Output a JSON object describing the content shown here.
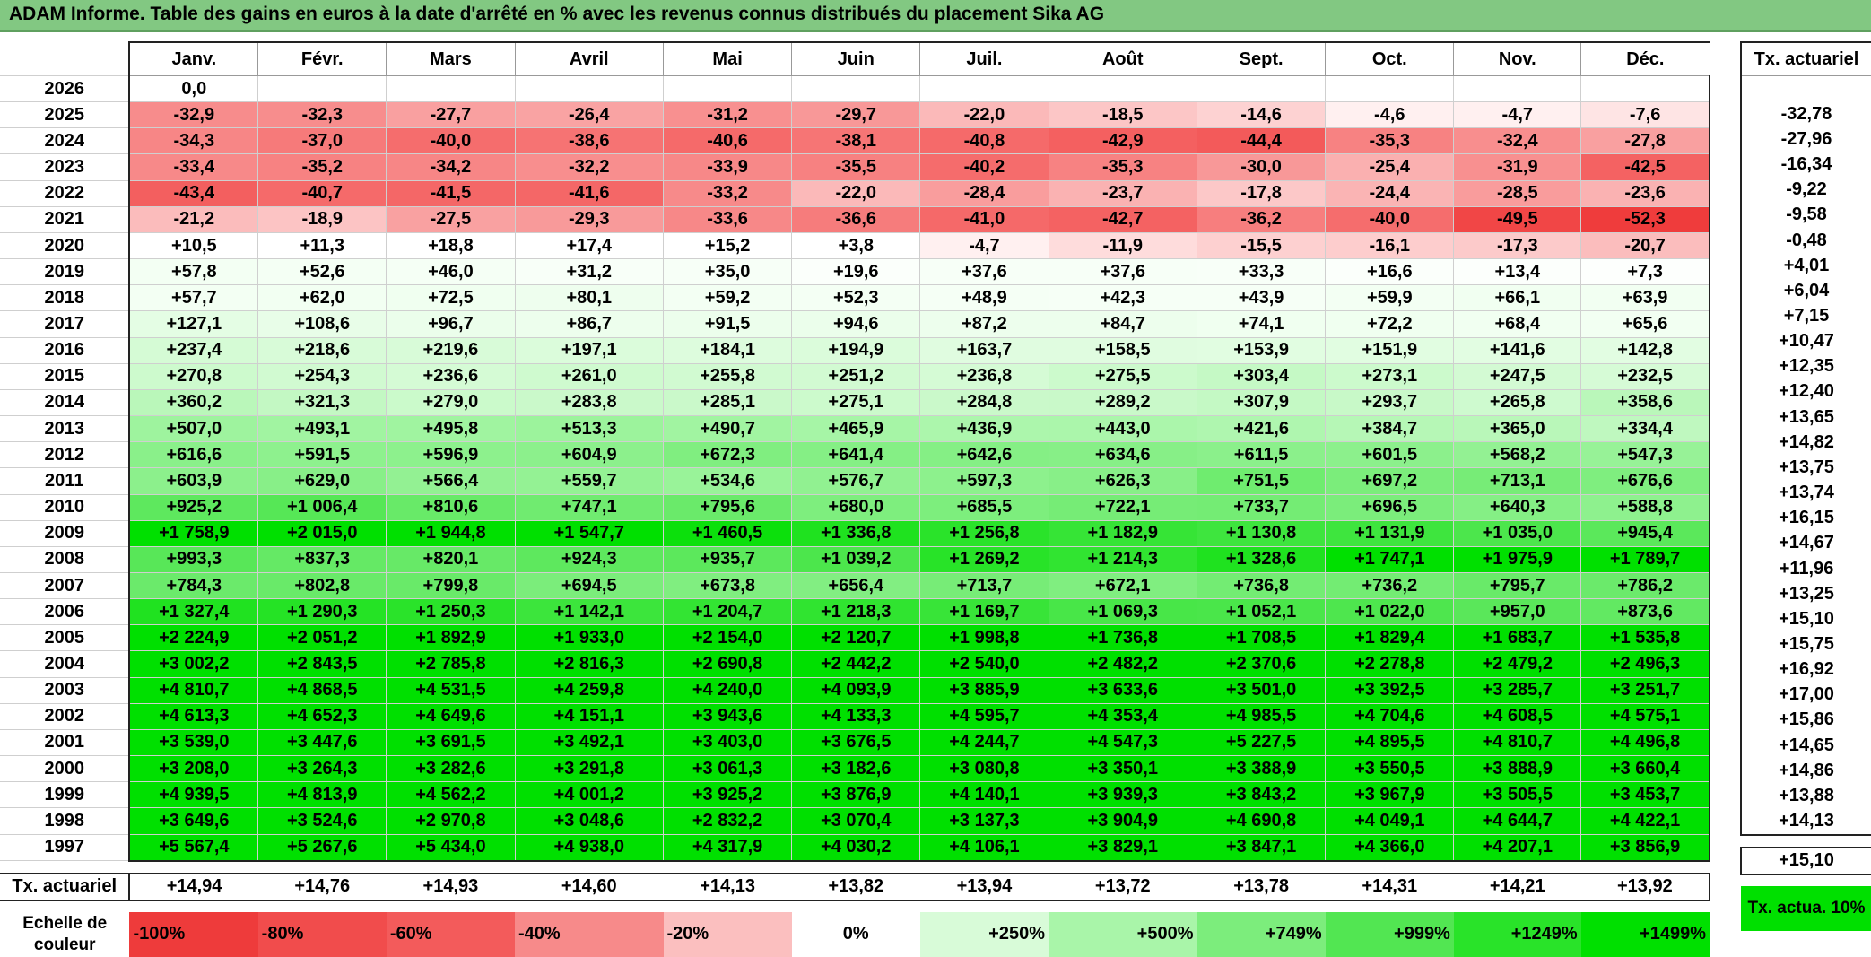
{
  "title": "ADAM Informe. Table des gains en euros à la date d'arrêté en % avec les revenus connus distribués du placement Sika AG",
  "months": [
    "Janv.",
    "Févr.",
    "Mars",
    "Avril",
    "Mai",
    "Juin",
    "Juil.",
    "Août",
    "Sept.",
    "Oct.",
    "Nov.",
    "Déc."
  ],
  "actuarial_header": "Tx. actuariel",
  "rows": [
    {
      "year": "2026",
      "values": [
        "0,0",
        "",
        "",
        "",
        "",
        "",
        "",
        "",
        "",
        "",
        "",
        ""
      ],
      "colors": [
        "#ffffff",
        "#ffffff",
        "#ffffff",
        "#ffffff",
        "#ffffff",
        "#ffffff",
        "#ffffff",
        "#ffffff",
        "#ffffff",
        "#ffffff",
        "#ffffff",
        "#ffffff"
      ],
      "rate": ""
    },
    {
      "year": "2025",
      "values": [
        "-32,9",
        "-32,3",
        "-27,7",
        "-26,4",
        "-31,2",
        "-29,7",
        "-22,0",
        "-18,5",
        "-14,6",
        "-4,6",
        "-4,7",
        "-7,6"
      ],
      "colors": [
        "#f78c8c",
        "#f78d8d",
        "#f9a0a0",
        "#f9a3a3",
        "#f89090",
        "#f89898",
        "#fbb9b9",
        "#fcc6c6",
        "#fdd2d2",
        "#fff0f0",
        "#fff0f0",
        "#fee4e4"
      ],
      "rate": "-32,78"
    },
    {
      "year": "2024",
      "values": [
        "-34,3",
        "-37,0",
        "-40,0",
        "-38,6",
        "-40,6",
        "-38,1",
        "-40,8",
        "-42,9",
        "-44,4",
        "-35,3",
        "-32,4",
        "-27,8"
      ],
      "colors": [
        "#f78686",
        "#f67a7a",
        "#f56d6d",
        "#f67373",
        "#f56a6a",
        "#f67575",
        "#f56a6a",
        "#f46060",
        "#f35a5a",
        "#f78282",
        "#f88e8e",
        "#f9a0a0"
      ],
      "rate": "-27,96"
    },
    {
      "year": "2023",
      "values": [
        "-33,4",
        "-35,2",
        "-34,2",
        "-32,2",
        "-33,9",
        "-35,5",
        "-40,2",
        "-35,3",
        "-30,0",
        "-25,4",
        "-31,9",
        "-42,5"
      ],
      "colors": [
        "#f78989",
        "#f78282",
        "#f78686",
        "#f88e8e",
        "#f78888",
        "#f78181",
        "#f56c6c",
        "#f78282",
        "#f89898",
        "#fab0b0",
        "#f89090",
        "#f46262"
      ],
      "rate": "-16,34"
    },
    {
      "year": "2022",
      "values": [
        "-43,4",
        "-40,7",
        "-41,5",
        "-41,6",
        "-33,2",
        "-22,0",
        "-28,4",
        "-23,7",
        "-17,8",
        "-24,4",
        "-28,5",
        "-23,6"
      ],
      "colors": [
        "#f35f5f",
        "#f56a6a",
        "#f46767",
        "#f46767",
        "#f78a8a",
        "#fbb9b9",
        "#f99d9d",
        "#fab2b2",
        "#fcc8c8",
        "#fab4b4",
        "#f99c9c",
        "#fab2b2"
      ],
      "rate": "-9,22"
    },
    {
      "year": "2021",
      "values": [
        "-21,2",
        "-18,9",
        "-27,5",
        "-29,3",
        "-33,6",
        "-36,6",
        "-41,0",
        "-42,7",
        "-36,2",
        "-40,0",
        "-49,5",
        "-52,3"
      ],
      "colors": [
        "#fbbcbc",
        "#fcc4c4",
        "#f9a1a1",
        "#f89a9a",
        "#f78888",
        "#f67c7c",
        "#f56969",
        "#f46262",
        "#f77e7e",
        "#f56d6d",
        "#f14646",
        "#ef3c3c"
      ],
      "rate": "-9,58"
    },
    {
      "year": "2020",
      "values": [
        "+10,5",
        "+11,3",
        "+18,8",
        "+17,4",
        "+15,2",
        "+3,8",
        "-4,7",
        "-11,9",
        "-15,5",
        "-16,1",
        "-17,3",
        "-20,7"
      ],
      "colors": [
        "#ffffff",
        "#ffffff",
        "#ffffff",
        "#ffffff",
        "#ffffff",
        "#ffffff",
        "#fff0f0",
        "#fedcdc",
        "#fdd0d0",
        "#fdcdcd",
        "#fccaca",
        "#fbbdbd"
      ],
      "rate": "-0,48"
    },
    {
      "year": "2019",
      "values": [
        "+57,8",
        "+52,6",
        "+46,0",
        "+31,2",
        "+35,0",
        "+19,6",
        "+37,6",
        "+37,6",
        "+33,3",
        "+16,6",
        "+13,4",
        "+7,3"
      ],
      "colors": [
        "#f3fff3",
        "#f4fff4",
        "#f5fff5",
        "#f8fff8",
        "#f7fff7",
        "#fbfffb",
        "#f7fff7",
        "#f7fff7",
        "#f8fff8",
        "#fbfffb",
        "#fcfffc",
        "#fdfffd"
      ],
      "rate": "+4,01"
    },
    {
      "year": "2018",
      "values": [
        "+57,7",
        "+62,0",
        "+72,5",
        "+80,1",
        "+59,2",
        "+52,3",
        "+48,9",
        "+42,3",
        "+43,9",
        "+59,9",
        "+66,1",
        "+63,9"
      ],
      "colors": [
        "#f3fff3",
        "#f2fff2",
        "#f0fff0",
        "#eefeee",
        "#f3fff3",
        "#f4fff4",
        "#f5fff5",
        "#f6fff6",
        "#f6fff6",
        "#f3fff3",
        "#f1fff1",
        "#f2fff2"
      ],
      "rate": "+6,04"
    },
    {
      "year": "2017",
      "values": [
        "+127,1",
        "+108,6",
        "+96,7",
        "+86,7",
        "+91,5",
        "+94,6",
        "+87,2",
        "+84,7",
        "+74,1",
        "+72,2",
        "+68,4",
        "+65,6"
      ],
      "colors": [
        "#e4fde4",
        "#e8fde8",
        "#ebfeeb",
        "#edfeed",
        "#ecfeec",
        "#ebfeeb",
        "#edfeed",
        "#edfeed",
        "#f0fff0",
        "#f0fff0",
        "#f1fff1",
        "#f2fff2"
      ],
      "rate": "+7,15"
    },
    {
      "year": "2016",
      "values": [
        "+237,4",
        "+218,6",
        "+219,6",
        "+197,1",
        "+184,1",
        "+194,9",
        "+163,7",
        "+158,5",
        "+153,9",
        "+151,9",
        "+141,6",
        "+142,8"
      ],
      "colors": [
        "#d5fbd5",
        "#d8fbd8",
        "#d8fbd8",
        "#dbfcdb",
        "#ddfcdd",
        "#dbfcdb",
        "#e0fce0",
        "#e0fce0",
        "#e1fde1",
        "#e1fde1",
        "#e2fde2",
        "#e2fde2"
      ],
      "rate": "+10,47"
    },
    {
      "year": "2015",
      "values": [
        "+270,8",
        "+254,3",
        "+236,6",
        "+261,0",
        "+255,8",
        "+251,2",
        "+236,8",
        "+275,5",
        "+303,4",
        "+273,1",
        "+247,5",
        "+232,5"
      ],
      "colors": [
        "#cdfacd",
        "#d1fad1",
        "#d5fbd5",
        "#cffacf",
        "#d1fad1",
        "#d2fad2",
        "#d5fbd5",
        "#ccfacc",
        "#c5f9c5",
        "#ccfacc",
        "#d3fad3",
        "#d6fbd6"
      ],
      "rate": "+12,35"
    },
    {
      "year": "2014",
      "values": [
        "+360,2",
        "+321,3",
        "+279,0",
        "+283,8",
        "+285,1",
        "+275,1",
        "+284,8",
        "+289,2",
        "+307,9",
        "+293,7",
        "+265,8",
        "+358,6"
      ],
      "colors": [
        "#baf7ba",
        "#c3f8c3",
        "#cbfacb",
        "#caf9ca",
        "#caf9ca",
        "#ccfacc",
        "#caf9ca",
        "#c9f9c9",
        "#c4f9c4",
        "#c8f9c8",
        "#cefacf",
        "#baf7ba"
      ],
      "rate": "+12,40"
    },
    {
      "year": "2013",
      "values": [
        "+507,0",
        "+493,1",
        "+495,8",
        "+513,3",
        "+490,7",
        "+465,9",
        "+436,9",
        "+443,0",
        "+421,6",
        "+384,7",
        "+365,0",
        "+334,4"
      ],
      "colors": [
        "#9ef39e",
        "#a1f4a1",
        "#a0f4a0",
        "#9cf39c",
        "#a1f4a1",
        "#a6f5a6",
        "#acf6ac",
        "#abf6ab",
        "#aff6af",
        "#b6f7b6",
        "#b9f7b9",
        "#bff8bf"
      ],
      "rate": "+13,65"
    },
    {
      "year": "2012",
      "values": [
        "+616,6",
        "+591,5",
        "+596,9",
        "+604,9",
        "+672,3",
        "+641,4",
        "+642,6",
        "+634,6",
        "+611,5",
        "+601,5",
        "+568,2",
        "+547,3"
      ],
      "colors": [
        "#8af08a",
        "#8ef18e",
        "#8df18d",
        "#8cf08c",
        "#80ee80",
        "#85ef85",
        "#85ef85",
        "#87ef87",
        "#8bf08b",
        "#8cf08c",
        "#93f193",
        "#97f297"
      ],
      "rate": "+14,82"
    },
    {
      "year": "2011",
      "values": [
        "+603,9",
        "+629,0",
        "+566,4",
        "+559,7",
        "+534,6",
        "+576,7",
        "+597,3",
        "+626,3",
        "+751,5",
        "+697,2",
        "+713,1",
        "+676,6"
      ],
      "colors": [
        "#8cf08c",
        "#88ef88",
        "#93f193",
        "#94f294",
        "#99f399",
        "#91f191",
        "#8df18d",
        "#88ef88",
        "#6fec6f",
        "#7bed7b",
        "#77ec77",
        "#7fee7f"
      ],
      "rate": "+13,75"
    },
    {
      "year": "2010",
      "values": [
        "+925,2",
        "+1 006,4",
        "+810,6",
        "+747,1",
        "+795,6",
        "+680,0",
        "+685,5",
        "+722,1",
        "+733,7",
        "+696,5",
        "+640,3",
        "+588,8"
      ],
      "colors": [
        "#5ee85e",
        "#56e756",
        "#68ea68",
        "#70eb70",
        "#6aea6a",
        "#7eee7e",
        "#7dee7d",
        "#76ec76",
        "#74ec74",
        "#7bed7b",
        "#85ef85",
        "#8ef18e"
      ],
      "rate": "+13,74"
    },
    {
      "year": "2009",
      "values": [
        "+1 758,9",
        "+2 015,0",
        "+1 944,8",
        "+1 547,7",
        "+1 460,5",
        "+1 336,8",
        "+1 256,8",
        "+1 182,9",
        "+1 130,8",
        "+1 131,9",
        "+1 035,0",
        "+945,4"
      ],
      "colors": [
        "#00e000",
        "#00e000",
        "#00e000",
        "#00e000",
        "#0ce00c",
        "#1fe21f",
        "#2ae32a",
        "#36e436",
        "#3ee53e",
        "#3ee53e",
        "#4ce64c",
        "#5be85b"
      ],
      "rate": "+16,15"
    },
    {
      "year": "2008",
      "values": [
        "+993,3",
        "+837,3",
        "+820,1",
        "+924,3",
        "+935,7",
        "+1 039,2",
        "+1 269,2",
        "+1 214,3",
        "+1 328,6",
        "+1 747,1",
        "+1 975,9",
        "+1 789,7"
      ],
      "colors": [
        "#58e758",
        "#65e965",
        "#67e967",
        "#5ee85e",
        "#5ce85c",
        "#4ce64c",
        "#28e328",
        "#31e431",
        "#1fe21f",
        "#00e000",
        "#00e000",
        "#00e000"
      ],
      "rate": "+14,67"
    },
    {
      "year": "2007",
      "values": [
        "+784,3",
        "+802,8",
        "+799,8",
        "+694,5",
        "+673,8",
        "+656,4",
        "+713,7",
        "+672,1",
        "+736,8",
        "+736,2",
        "+795,7",
        "+786,2"
      ],
      "colors": [
        "#6bea6b",
        "#69ea69",
        "#69ea69",
        "#7bed7b",
        "#80ee80",
        "#82ee82",
        "#77ec77",
        "#80ee80",
        "#73ec73",
        "#73ec73",
        "#69ea69",
        "#6bea6b"
      ],
      "rate": "+11,96"
    },
    {
      "year": "2006",
      "values": [
        "+1 327,4",
        "+1 290,3",
        "+1 250,3",
        "+1 142,1",
        "+1 204,7",
        "+1 218,3",
        "+1 169,7",
        "+1 069,3",
        "+1 052,1",
        "+1 022,0",
        "+957,0",
        "+873,6"
      ],
      "colors": [
        "#20e220",
        "#25e325",
        "#2ae32a",
        "#3ce53c",
        "#33e433",
        "#30e430",
        "#38e438",
        "#48e648",
        "#4ae64a",
        "#4ee64e",
        "#5ae75a",
        "#62e962"
      ],
      "rate": "+13,25"
    },
    {
      "year": "2005",
      "values": [
        "+2 224,9",
        "+2 051,2",
        "+1 892,9",
        "+1 933,0",
        "+2 154,0",
        "+2 120,7",
        "+1 998,8",
        "+1 736,8",
        "+1 708,5",
        "+1 829,4",
        "+1 683,7",
        "+1 535,8"
      ],
      "colors": [
        "#00e000",
        "#00e000",
        "#00e000",
        "#00e000",
        "#00e000",
        "#00e000",
        "#00e000",
        "#00e000",
        "#00e000",
        "#00e000",
        "#00e000",
        "#00e000"
      ],
      "rate": "+15,10"
    },
    {
      "year": "2004",
      "values": [
        "+3 002,2",
        "+2 843,5",
        "+2 785,8",
        "+2 816,3",
        "+2 690,8",
        "+2 442,2",
        "+2 540,0",
        "+2 482,2",
        "+2 370,6",
        "+2 278,8",
        "+2 479,2",
        "+2 496,3"
      ],
      "colors": [
        "#00e000",
        "#00e000",
        "#00e000",
        "#00e000",
        "#00e000",
        "#00e000",
        "#00e000",
        "#00e000",
        "#00e000",
        "#00e000",
        "#00e000",
        "#00e000"
      ],
      "rate": "+15,75"
    },
    {
      "year": "2003",
      "values": [
        "+4 810,7",
        "+4 868,5",
        "+4 531,5",
        "+4 259,8",
        "+4 240,0",
        "+4 093,9",
        "+3 885,9",
        "+3 633,6",
        "+3 501,0",
        "+3 392,5",
        "+3 285,7",
        "+3 251,7"
      ],
      "colors": [
        "#00e000",
        "#00e000",
        "#00e000",
        "#00e000",
        "#00e000",
        "#00e000",
        "#00e000",
        "#00e000",
        "#00e000",
        "#00e000",
        "#00e000",
        "#00e000"
      ],
      "rate": "+16,92"
    },
    {
      "year": "2002",
      "values": [
        "+4 613,3",
        "+4 652,3",
        "+4 649,6",
        "+4 151,1",
        "+3 943,6",
        "+4 133,3",
        "+4 595,7",
        "+4 353,4",
        "+4 985,5",
        "+4 704,6",
        "+4 608,5",
        "+4 575,1"
      ],
      "colors": [
        "#00e000",
        "#00e000",
        "#00e000",
        "#00e000",
        "#00e000",
        "#00e000",
        "#00e000",
        "#00e000",
        "#00e000",
        "#00e000",
        "#00e000",
        "#00e000"
      ],
      "rate": "+17,00"
    },
    {
      "year": "2001",
      "values": [
        "+3 539,0",
        "+3 447,6",
        "+3 691,5",
        "+3 492,1",
        "+3 403,0",
        "+3 676,5",
        "+4 244,7",
        "+4 547,3",
        "+5 227,5",
        "+4 895,5",
        "+4 810,7",
        "+4 496,8"
      ],
      "colors": [
        "#00e000",
        "#00e000",
        "#00e000",
        "#00e000",
        "#00e000",
        "#00e000",
        "#00e000",
        "#00e000",
        "#00e000",
        "#00e000",
        "#00e000",
        "#00e000"
      ],
      "rate": "+15,86"
    },
    {
      "year": "2000",
      "values": [
        "+3 208,0",
        "+3 264,3",
        "+3 282,6",
        "+3 291,8",
        "+3 061,3",
        "+3 182,6",
        "+3 080,8",
        "+3 350,1",
        "+3 388,9",
        "+3 550,5",
        "+3 888,9",
        "+3 660,4"
      ],
      "colors": [
        "#00e000",
        "#00e000",
        "#00e000",
        "#00e000",
        "#00e000",
        "#00e000",
        "#00e000",
        "#00e000",
        "#00e000",
        "#00e000",
        "#00e000",
        "#00e000"
      ],
      "rate": "+14,65"
    },
    {
      "year": "1999",
      "values": [
        "+4 939,5",
        "+4 813,9",
        "+4 562,2",
        "+4 001,2",
        "+3 925,2",
        "+3 876,9",
        "+4 140,1",
        "+3 939,3",
        "+3 843,2",
        "+3 967,9",
        "+3 505,5",
        "+3 453,7"
      ],
      "colors": [
        "#00e000",
        "#00e000",
        "#00e000",
        "#00e000",
        "#00e000",
        "#00e000",
        "#00e000",
        "#00e000",
        "#00e000",
        "#00e000",
        "#00e000",
        "#00e000"
      ],
      "rate": "+14,86"
    },
    {
      "year": "1998",
      "values": [
        "+3 649,6",
        "+3 524,6",
        "+2 970,8",
        "+3 048,6",
        "+2 832,2",
        "+3 070,4",
        "+3 137,3",
        "+3 904,9",
        "+4 690,8",
        "+4 049,1",
        "+4 644,7",
        "+4 422,1"
      ],
      "colors": [
        "#00e000",
        "#00e000",
        "#00e000",
        "#00e000",
        "#00e000",
        "#00e000",
        "#00e000",
        "#00e000",
        "#00e000",
        "#00e000",
        "#00e000",
        "#00e000"
      ],
      "rate": "+13,88"
    },
    {
      "year": "1997",
      "values": [
        "+5 567,4",
        "+5 267,6",
        "+5 434,0",
        "+4 938,0",
        "+4 317,9",
        "+4 030,2",
        "+4 106,1",
        "+3 829,1",
        "+3 847,1",
        "+4 366,0",
        "+4 207,1",
        "+3 856,9"
      ],
      "colors": [
        "#00e000",
        "#00e000",
        "#00e000",
        "#00e000",
        "#00e000",
        "#00e000",
        "#00e000",
        "#00e000",
        "#00e000",
        "#00e000",
        "#00e000",
        "#00e000"
      ],
      "rate": "+14,13"
    }
  ],
  "actuarial_row": {
    "label": "Tx. actuariel",
    "values": [
      "+14,94",
      "+14,76",
      "+14,93",
      "+14,60",
      "+14,13",
      "+13,82",
      "+13,94",
      "+13,72",
      "+13,78",
      "+14,31",
      "+14,21",
      "+13,92"
    ],
    "total": "+15,10"
  },
  "color_scale": {
    "label": "Echelle de couleur",
    "items": [
      {
        "text": "-100%",
        "color": "#ee3b3b",
        "kind": "neg"
      },
      {
        "text": "-80%",
        "color": "#f14c4c",
        "kind": "neg"
      },
      {
        "text": "-60%",
        "color": "#f35b5b",
        "kind": "neg"
      },
      {
        "text": "-40%",
        "color": "#f78a8a",
        "kind": "neg"
      },
      {
        "text": "-20%",
        "color": "#fbbfbf",
        "kind": "neg"
      },
      {
        "text": "0%",
        "color": "#ffffff",
        "kind": "zero"
      },
      {
        "text": "+250%",
        "color": "#d8fbd8",
        "kind": "pos"
      },
      {
        "text": "+500%",
        "color": "#a9f5a9",
        "kind": "pos"
      },
      {
        "text": "+749%",
        "color": "#7ced7c",
        "kind": "pos"
      },
      {
        "text": "+999%",
        "color": "#52e652",
        "kind": "pos"
      },
      {
        "text": "+1249%",
        "color": "#29e329",
        "kind": "pos"
      },
      {
        "text": "+1499%",
        "color": "#00e000",
        "kind": "pos"
      }
    ],
    "side_label": "Tx. actua. 10%",
    "side_color": "#00e000"
  }
}
